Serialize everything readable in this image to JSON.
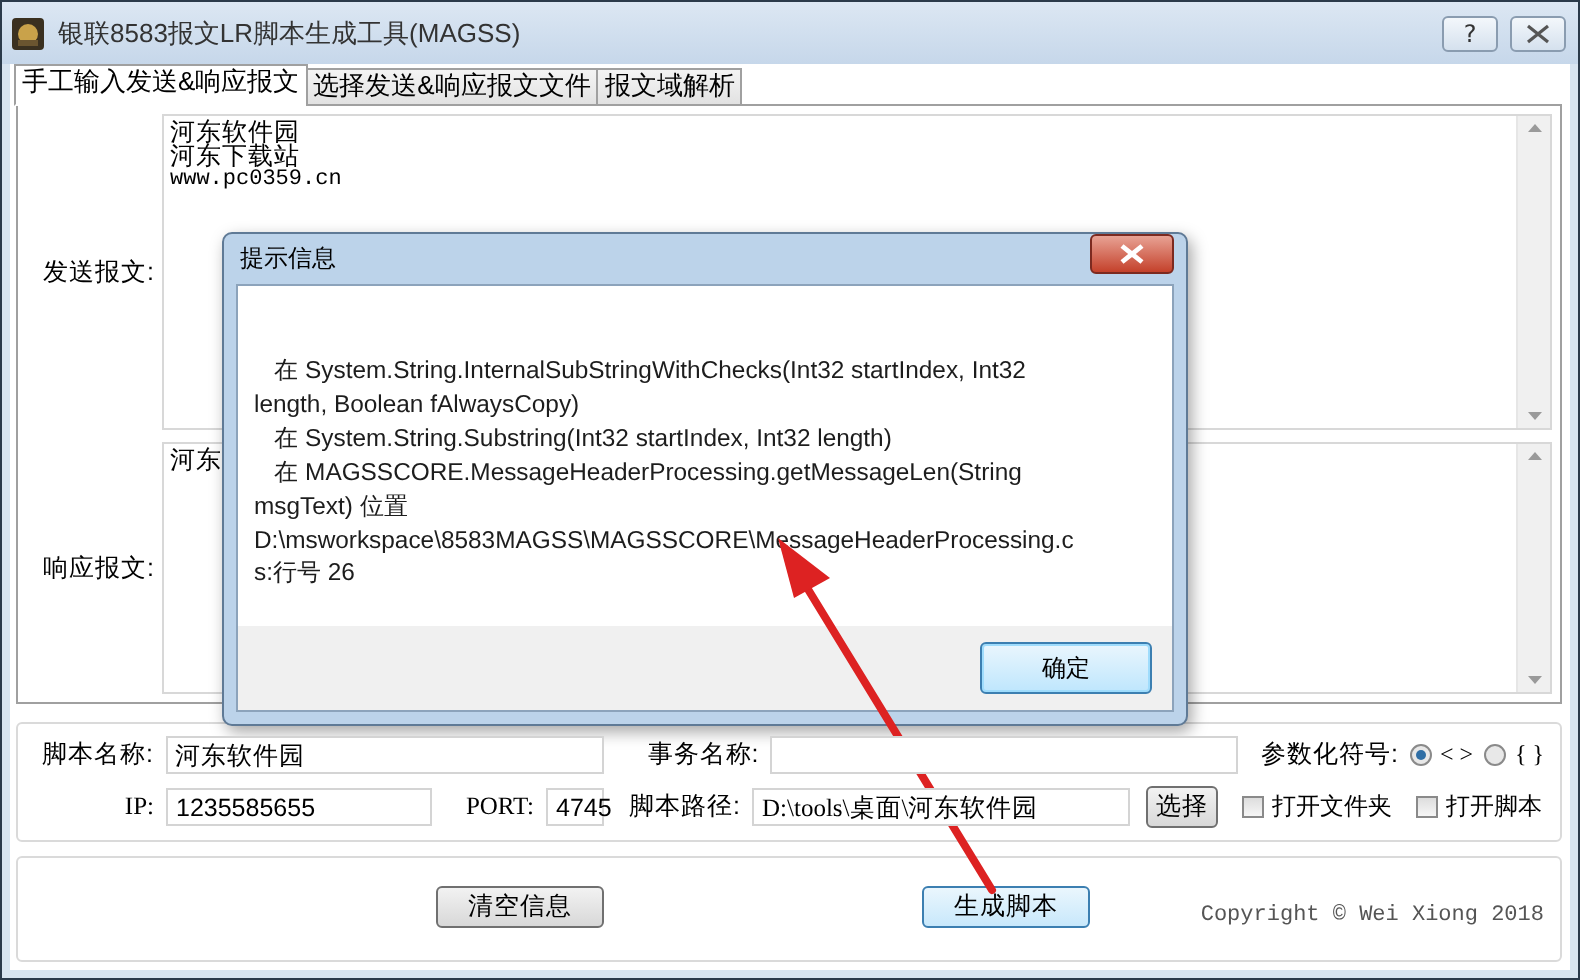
{
  "window": {
    "title": "银联8583报文LR脚本生成工具(MAGSS)",
    "help_button": "?"
  },
  "tabs": [
    {
      "label": "手工输入发送&响应报文",
      "selected": true
    },
    {
      "label": "选择发送&响应报文文件",
      "selected": false
    },
    {
      "label": "报文域解析",
      "selected": false
    }
  ],
  "send": {
    "label": "发送报文:",
    "lines": [
      "河东软件园",
      "河东下载站",
      "www.pc0359.cn"
    ]
  },
  "response": {
    "label": "响应报文:",
    "value": "河东"
  },
  "settings": {
    "script_name": {
      "label": "脚本名称:",
      "value": "河东软件园"
    },
    "transaction": {
      "label": "事务名称:"
    },
    "param_symbol": {
      "label": "参数化符号:",
      "options": [
        {
          "label": "< >",
          "selected": true
        },
        {
          "label": "{ }",
          "selected": false
        }
      ]
    },
    "ip": {
      "label": "IP:",
      "value": "1235585655"
    },
    "port": {
      "label": "PORT:",
      "value": "4745"
    },
    "script_path": {
      "label": "脚本路径:",
      "value": "D:\\tools\\桌面\\河东软件园"
    },
    "choose_button": "选择",
    "checkboxes": [
      {
        "label": "打开文件夹",
        "checked": false
      },
      {
        "label": "打开脚本",
        "checked": false
      }
    ]
  },
  "actions": {
    "clear_button": "清空信息",
    "generate_button": "生成脚本",
    "copyright": "Copyright © Wei Xiong 2018"
  },
  "dialog": {
    "title": "提示信息",
    "lines": [
      "   在 System.String.InternalSubStringWithChecks(Int32 startIndex, Int32",
      "length, Boolean fAlwaysCopy)",
      "   在 System.String.Substring(Int32 startIndex, Int32 length)",
      "   在 MAGSSCORE.MessageHeaderProcessing.getMessageLen(String",
      "msgText) 位置",
      "D:\\msworkspace\\8583MAGSS\\MAGSSCORE\\MessageHeaderProcessing.c",
      "s:行号 26"
    ],
    "ok_button": "确定"
  }
}
